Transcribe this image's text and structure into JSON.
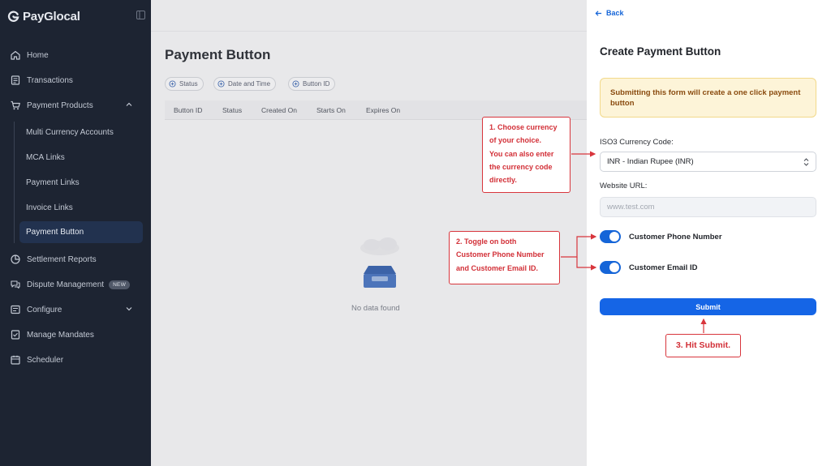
{
  "sidebar": {
    "brand": "PayGlocal",
    "items": [
      {
        "label": "Home",
        "icon": "home-icon"
      },
      {
        "label": "Transactions",
        "icon": "receipt-icon"
      },
      {
        "label": "Payment Products",
        "icon": "cart-icon"
      },
      {
        "label": "Settlement Reports",
        "icon": "pie-chart-icon"
      },
      {
        "label": "Dispute Management",
        "icon": "dispute-icon",
        "badge": "NEW"
      },
      {
        "label": "Configure",
        "icon": "configure-icon"
      },
      {
        "label": "Manage Mandates",
        "icon": "mandate-icon"
      },
      {
        "label": "Scheduler",
        "icon": "scheduler-icon"
      }
    ],
    "sub_items": [
      {
        "label": "Multi Currency Accounts"
      },
      {
        "label": "MCA Links"
      },
      {
        "label": "Payment Links"
      },
      {
        "label": "Invoice Links"
      },
      {
        "label": "Payment Button",
        "active": true
      }
    ]
  },
  "main": {
    "title": "Payment Button",
    "filters": [
      "Status",
      "Date and Time",
      "Button ID"
    ],
    "columns": [
      "Button ID",
      "Status",
      "Created On",
      "Starts On",
      "Expires On"
    ],
    "empty_text": "No data found"
  },
  "panel": {
    "back_label": "Back",
    "title": "Create Payment Button",
    "alert": "Submitting this form will create a one click payment button",
    "currency_label": "ISO3 Currency Code:",
    "currency_value": "INR - Indian Rupee (INR)",
    "website_label": "Website URL:",
    "website_placeholder": "www.test.com",
    "toggle_phone": "Customer Phone Number",
    "toggle_email": "Customer Email ID",
    "phone_enabled": true,
    "email_enabled": true,
    "submit_label": "Submit"
  },
  "annotations": {
    "note1": [
      "1. Choose currency",
      "of your choice.",
      "You can also enter",
      "the currency code",
      "directly."
    ],
    "note2": [
      "2. Toggle on both",
      "Customer Phone Number",
      "and Customer Email ID."
    ],
    "note3": "3. Hit Submit."
  },
  "colors": {
    "sidebar_bg": "#1d2432",
    "accent": "#1565d8",
    "annotation": "#d22f37",
    "alert_bg": "#fdf4d8"
  }
}
